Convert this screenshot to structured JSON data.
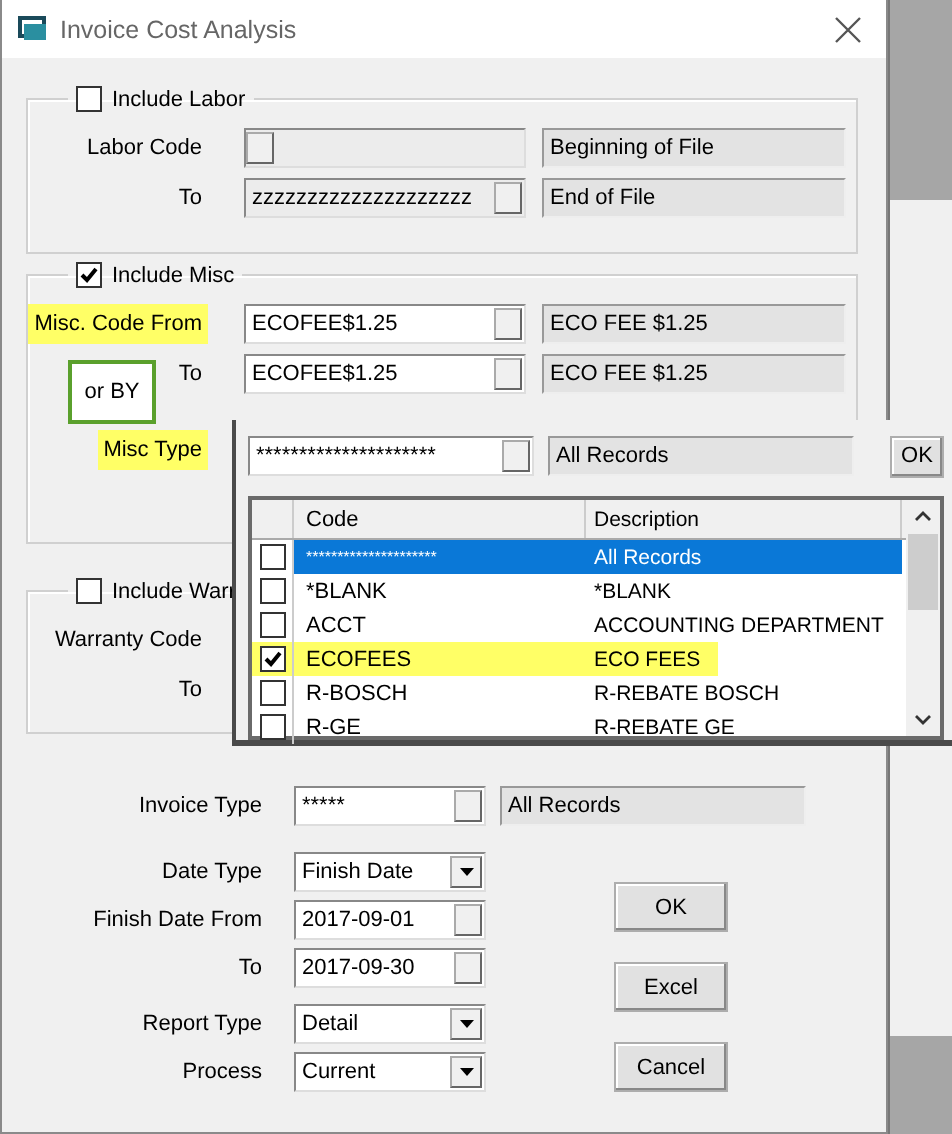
{
  "window": {
    "title": "Invoice Cost Analysis"
  },
  "labor": {
    "label": "Include Labor",
    "checked": false,
    "rows": [
      {
        "label": "Labor Code",
        "highlighted": false,
        "description": "Beginning of File"
      },
      {
        "label": "To",
        "highlighted": false,
        "code": "zzzzzzzzzzzzzzzzzzzz",
        "description": "End of File"
      }
    ]
  },
  "misc": {
    "label": "Include Misc",
    "checked": true,
    "rows": [
      {
        "label": "Misc. Code From",
        "highlighted": true,
        "code": "ECOFEE$1.25",
        "description": "ECO FEE $1.25"
      },
      {
        "label": "To",
        "highlighted": false,
        "code": "ECOFEE$1.25",
        "description": "ECO FEE $1.25"
      }
    ],
    "note": "or BY",
    "type_label": "Misc Type",
    "type_highlighted": true
  },
  "warranty": {
    "label": "Include Warr",
    "checked": false,
    "rows": [
      {
        "label": "Warranty Code"
      },
      {
        "label": "To"
      }
    ]
  },
  "lookup": {
    "code": "*********************",
    "description": "All Records",
    "ok": "OK",
    "columns": [
      "Code",
      "Description"
    ],
    "rows": [
      {
        "code": "*********************",
        "description": "All Records",
        "checked": false,
        "selected": true,
        "highlighted": false
      },
      {
        "code": "*BLANK",
        "description": "*BLANK",
        "checked": false,
        "selected": false,
        "highlighted": false
      },
      {
        "code": "ACCT",
        "description": "ACCOUNTING DEPARTMENT",
        "checked": false,
        "selected": false,
        "highlighted": false
      },
      {
        "code": "ECOFEES",
        "description": "ECO FEES",
        "checked": true,
        "selected": false,
        "highlighted": true
      },
      {
        "code": "R-BOSCH",
        "description": "R-REBATE BOSCH",
        "checked": false,
        "selected": false,
        "highlighted": false
      },
      {
        "code": "R-GE",
        "description": "R-REBATE GE",
        "checked": false,
        "selected": false,
        "highlighted": false
      }
    ]
  },
  "invoice_type": {
    "label": "Invoice Type",
    "code": "*****",
    "description": "All Records"
  },
  "criteria": [
    {
      "kind": "dropdown",
      "label": "Date Type",
      "value": "Finish Date"
    },
    {
      "kind": "date",
      "label": "Finish Date From",
      "value": "2017-09-01"
    },
    {
      "kind": "date",
      "label": "To",
      "value": "2017-09-30"
    },
    {
      "kind": "dropdown",
      "label": "Report Type",
      "value": "Detail"
    },
    {
      "kind": "dropdown",
      "label": "Process",
      "value": "Current"
    }
  ],
  "buttons": [
    "OK",
    "Excel",
    "Cancel"
  ]
}
